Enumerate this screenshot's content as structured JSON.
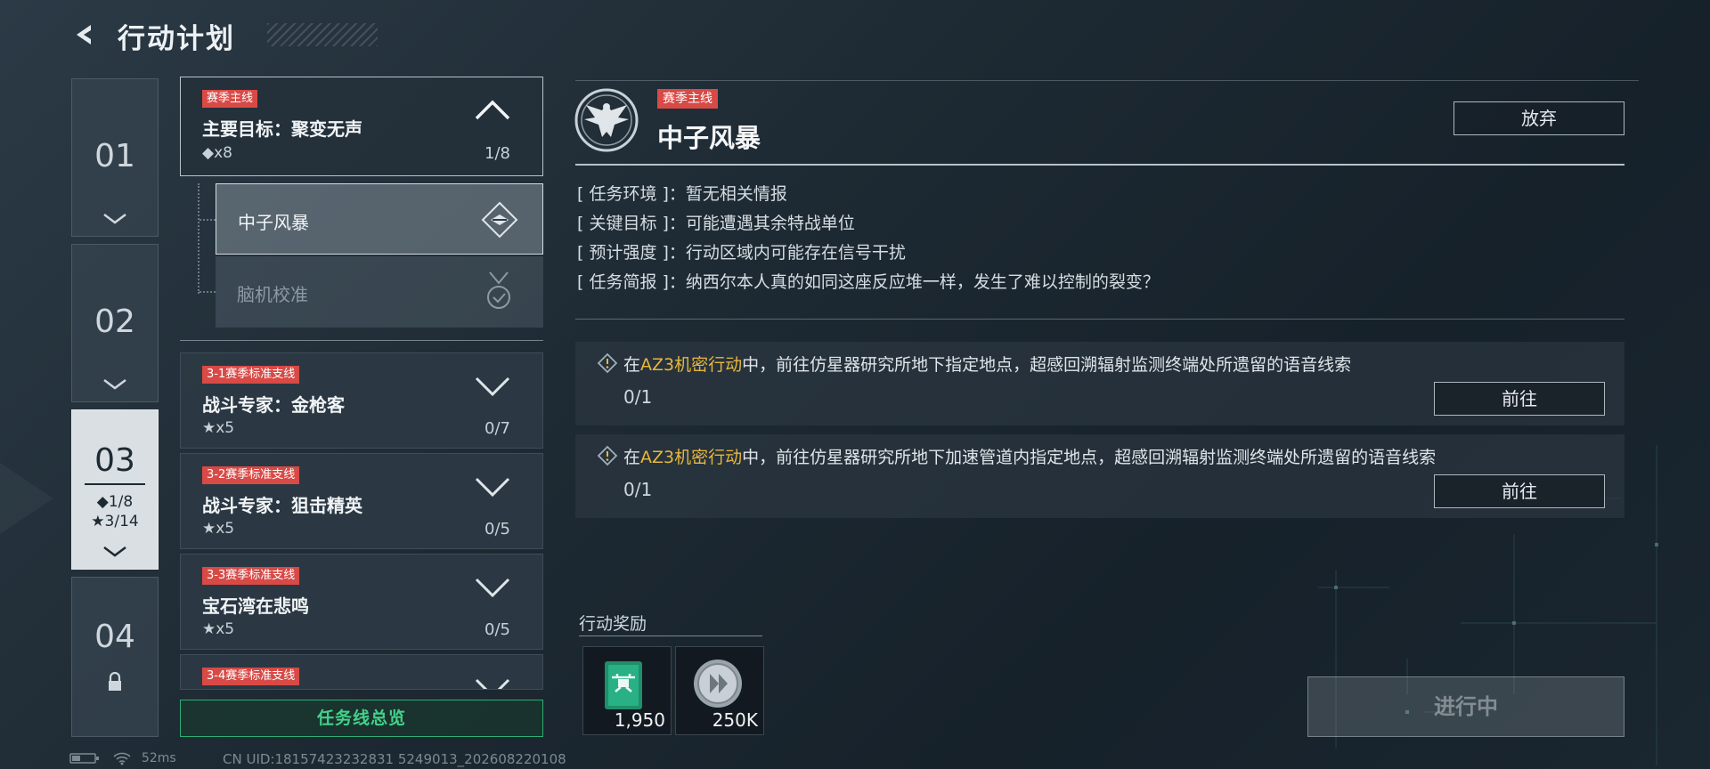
{
  "header": {
    "title": "行动计划"
  },
  "chapters": [
    {
      "number": "01",
      "state": "collapsed"
    },
    {
      "number": "02",
      "state": "collapsed"
    },
    {
      "number": "03",
      "state": "active",
      "diamond_progress": "◆1/8",
      "star_progress": "★3/14"
    },
    {
      "number": "04",
      "state": "locked"
    }
  ],
  "mission_list": {
    "main": {
      "tag": "赛季主线",
      "title": "主要目标：聚变无声",
      "reward": "◆x8",
      "progress": "1/8",
      "sub_items": [
        {
          "label": "中子风暴",
          "selected": true
        },
        {
          "label": "脑机校准",
          "selected": false
        }
      ]
    },
    "branches": [
      {
        "tag": "3-1赛季标准支线",
        "title": "战斗专家：金枪客",
        "reward": "★x5",
        "progress": "0/7"
      },
      {
        "tag": "3-2赛季标准支线",
        "title": "战斗专家：狙击精英",
        "reward": "★x5",
        "progress": "0/5"
      },
      {
        "tag": "3-3赛季标准支线",
        "title": "宝石湾在悲鸣",
        "reward": "★x5",
        "progress": "0/5"
      },
      {
        "tag": "3-4赛季标准支线"
      }
    ],
    "overview_button": "任务线总览"
  },
  "detail": {
    "tag": "赛季主线",
    "title": "中子风暴",
    "abandon_button": "放弃",
    "info": [
      {
        "key": "[ 任务环境 ]：",
        "value": "暂无相关情报"
      },
      {
        "key": "[ 关键目标 ]：",
        "value": "可能遭遇其余特战单位"
      },
      {
        "key": "[ 预计强度 ]：",
        "value": "行动区域内可能存在信号干扰"
      },
      {
        "key": "[ 任务简报 ]：",
        "value": "纳西尔本人真的如同这座反应堆一样，发生了难以控制的裂变？"
      }
    ],
    "tasks": [
      {
        "prefix": "在",
        "highlight": "AZ3机密行动",
        "suffix": "中，前往仿星器研究所地下指定地点，超感回溯辐射监测终端处所遗留的语音线索",
        "count": "0/1",
        "button": "前往"
      },
      {
        "prefix": "在",
        "highlight": "AZ3机密行动",
        "suffix": "中，前往仿星器研究所地下加速管道内指定地点，超感回溯辐射监测终端处所遗留的语音线索",
        "count": "0/1",
        "button": "前往"
      }
    ],
    "rewards_label": "行动奖励",
    "rewards": [
      {
        "icon": "drone-card-icon",
        "value": "1,950"
      },
      {
        "icon": "silver-coin-icon",
        "value": "250K"
      }
    ],
    "status_button": "进行中"
  },
  "footer": {
    "ping": "52ms",
    "uid": "CN UID:18157423232831 5249013_202608220108"
  },
  "colors": {
    "tag_red": "#d84a46",
    "highlight_gold": "#e8b73c",
    "overview_green": "#43d18a"
  }
}
